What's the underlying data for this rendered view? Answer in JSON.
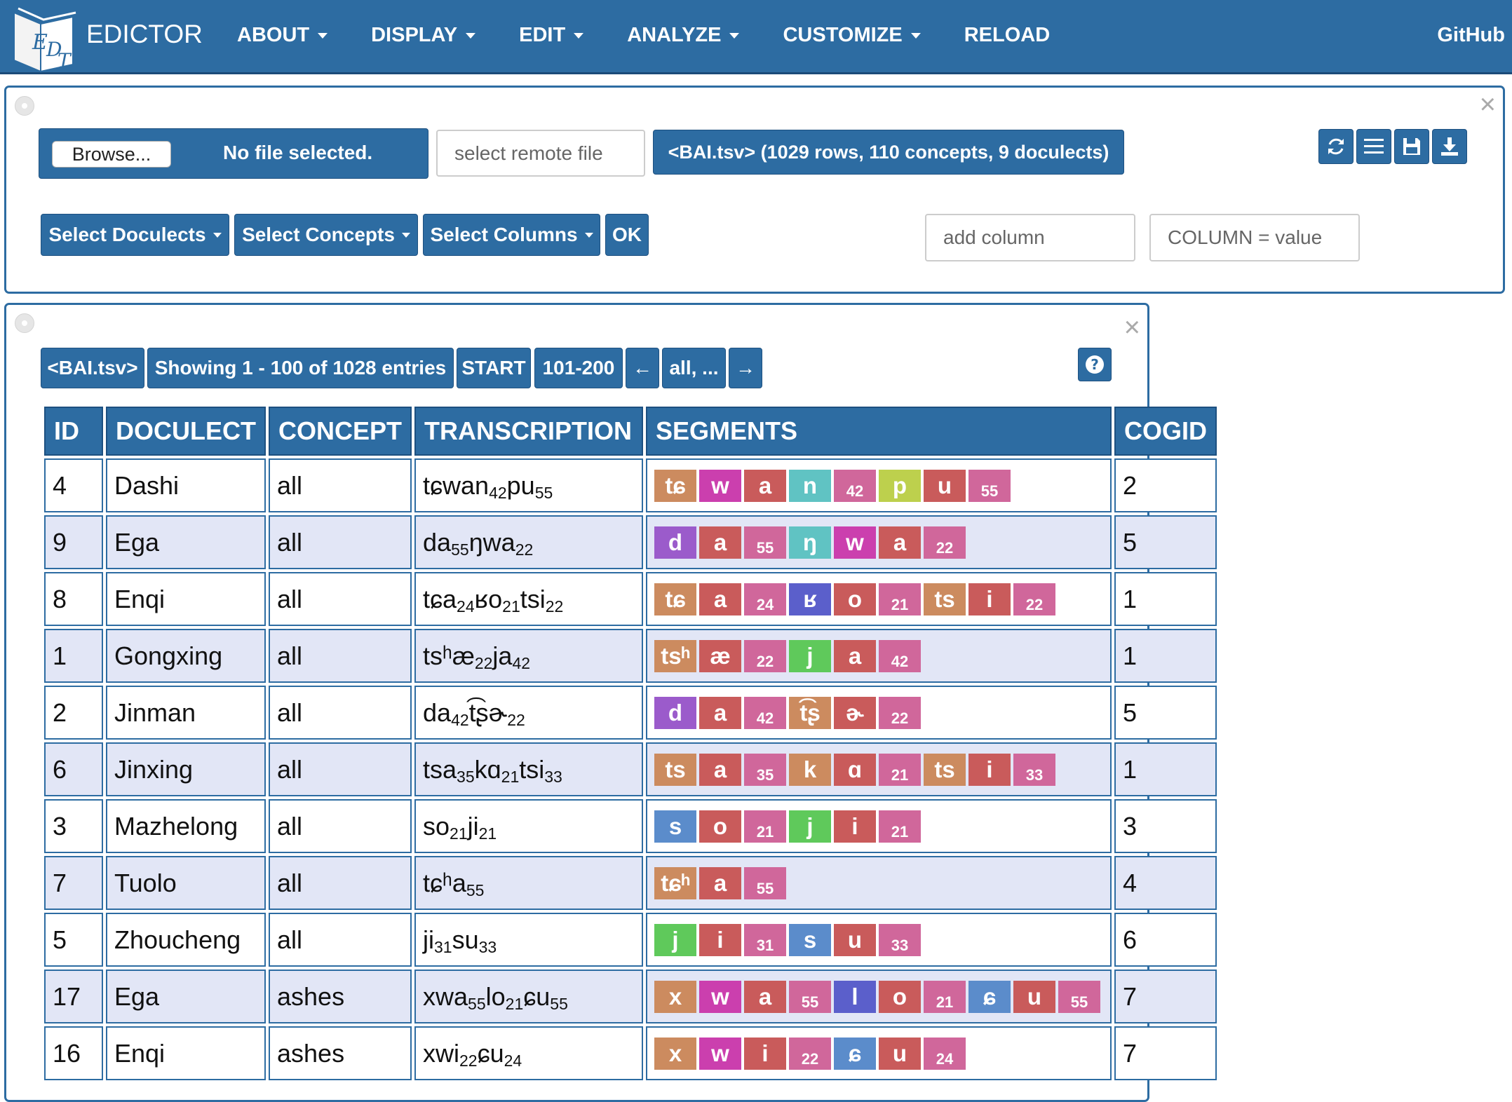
{
  "navbar": {
    "brand": "EDICTOR",
    "items": [
      {
        "label": "ABOUT",
        "dropdown": true
      },
      {
        "label": "DISPLAY",
        "dropdown": true
      },
      {
        "label": "EDIT",
        "dropdown": true
      },
      {
        "label": "ANALYZE",
        "dropdown": true
      },
      {
        "label": "CUSTOMIZE",
        "dropdown": true
      },
      {
        "label": "RELOAD",
        "dropdown": false
      }
    ],
    "github": "GitHub"
  },
  "file_panel": {
    "browse_label": "Browse...",
    "no_file_label": "No file selected.",
    "remote_placeholder": "select remote file",
    "file_info": "<BAI.tsv> (1029 rows, 110 concepts, 9 doculects)",
    "icons": [
      "refresh-icon",
      "list-icon",
      "save-icon",
      "download-icon"
    ],
    "select_doculects": "Select Doculects",
    "select_concepts": "Select Concepts",
    "select_columns": "Select Columns",
    "ok": "OK",
    "add_column_placeholder": "add column",
    "filter_placeholder": "COLUMN = value"
  },
  "table_panel": {
    "pager": {
      "file": "<BAI.tsv>",
      "showing": "Showing 1 - 100 of 1028 entries",
      "start": "START",
      "next_range": "101-200",
      "prev": "←",
      "all": "all, ...",
      "next": "→"
    },
    "help_icon": "question-circle-icon",
    "columns": [
      "ID",
      "DOCULECT",
      "CONCEPT",
      "TRANSCRIPTION",
      "SEGMENTS",
      "COGID"
    ],
    "rows": [
      {
        "id": "4",
        "doculect": "Dashi",
        "concept": "all",
        "transcription": [
          [
            "tɕwan",
            ""
          ],
          [
            "42",
            "s"
          ],
          [
            "pu",
            ""
          ],
          [
            "55",
            "s"
          ]
        ],
        "segments": [
          [
            "tɕ",
            "brown"
          ],
          [
            "w",
            "pink"
          ],
          [
            "a",
            "red"
          ],
          [
            "n",
            "teal"
          ],
          [
            "42",
            "rose"
          ],
          [
            "p",
            "olive"
          ],
          [
            "u",
            "red"
          ],
          [
            "55",
            "rose"
          ]
        ],
        "cogid": "2"
      },
      {
        "id": "9",
        "doculect": "Ega",
        "concept": "all",
        "transcription": [
          [
            "da",
            ""
          ],
          [
            "55",
            "s"
          ],
          [
            "ŋwa",
            ""
          ],
          [
            "22",
            "s"
          ]
        ],
        "segments": [
          [
            "d",
            "purple"
          ],
          [
            "a",
            "red"
          ],
          [
            "55",
            "rose"
          ],
          [
            "ŋ",
            "teal"
          ],
          [
            "w",
            "pink"
          ],
          [
            "a",
            "red"
          ],
          [
            "22",
            "rose"
          ]
        ],
        "cogid": "5"
      },
      {
        "id": "8",
        "doculect": "Enqi",
        "concept": "all",
        "transcription": [
          [
            "tɕa",
            ""
          ],
          [
            "24",
            "s"
          ],
          [
            "ʁo",
            ""
          ],
          [
            "21",
            "s"
          ],
          [
            "tsi",
            ""
          ],
          [
            "22",
            "s"
          ]
        ],
        "segments": [
          [
            "tɕ",
            "brown"
          ],
          [
            "a",
            "red"
          ],
          [
            "24",
            "rose"
          ],
          [
            "ʁ",
            "blue"
          ],
          [
            "o",
            "red"
          ],
          [
            "21",
            "rose"
          ],
          [
            "ts",
            "brown"
          ],
          [
            "i",
            "red"
          ],
          [
            "22",
            "rose"
          ]
        ],
        "cogid": "1"
      },
      {
        "id": "1",
        "doculect": "Gongxing",
        "concept": "all",
        "transcription": [
          [
            "tsʰæ",
            ""
          ],
          [
            "22",
            "s"
          ],
          [
            "ja",
            ""
          ],
          [
            "42",
            "s"
          ]
        ],
        "segments": [
          [
            "tsʰ",
            "brown"
          ],
          [
            "æ",
            "red"
          ],
          [
            "22",
            "rose"
          ],
          [
            "j",
            "green"
          ],
          [
            "a",
            "red"
          ],
          [
            "42",
            "rose"
          ]
        ],
        "cogid": "1"
      },
      {
        "id": "2",
        "doculect": "Jinman",
        "concept": "all",
        "transcription": [
          [
            "da",
            ""
          ],
          [
            "42",
            "s"
          ],
          [
            "t͡ʂɚ",
            ""
          ],
          [
            "22",
            "s"
          ]
        ],
        "segments": [
          [
            "d",
            "purple"
          ],
          [
            "a",
            "red"
          ],
          [
            "42",
            "rose"
          ],
          [
            "t͡ʂ",
            "brown"
          ],
          [
            "ɚ",
            "red"
          ],
          [
            "22",
            "rose"
          ]
        ],
        "cogid": "5"
      },
      {
        "id": "6",
        "doculect": "Jinxing",
        "concept": "all",
        "transcription": [
          [
            "tsa",
            ""
          ],
          [
            "35",
            "s"
          ],
          [
            "kɑ",
            ""
          ],
          [
            "21",
            "s"
          ],
          [
            "tsi",
            ""
          ],
          [
            "33",
            "s"
          ]
        ],
        "segments": [
          [
            "ts",
            "brown"
          ],
          [
            "a",
            "red"
          ],
          [
            "35",
            "rose"
          ],
          [
            "k",
            "brown"
          ],
          [
            "ɑ",
            "red"
          ],
          [
            "21",
            "rose"
          ],
          [
            "ts",
            "brown"
          ],
          [
            "i",
            "red"
          ],
          [
            "33",
            "rose"
          ]
        ],
        "cogid": "1"
      },
      {
        "id": "3",
        "doculect": "Mazhelong",
        "concept": "all",
        "transcription": [
          [
            "so",
            ""
          ],
          [
            "21",
            "s"
          ],
          [
            "ji",
            ""
          ],
          [
            "21",
            "s"
          ]
        ],
        "segments": [
          [
            "s",
            "steel"
          ],
          [
            "o",
            "red"
          ],
          [
            "21",
            "rose"
          ],
          [
            "j",
            "green"
          ],
          [
            "i",
            "red"
          ],
          [
            "21",
            "rose"
          ]
        ],
        "cogid": "3"
      },
      {
        "id": "7",
        "doculect": "Tuolo",
        "concept": "all",
        "transcription": [
          [
            "tɕʰa",
            ""
          ],
          [
            "55",
            "s"
          ]
        ],
        "segments": [
          [
            "tɕʰ",
            "brown"
          ],
          [
            "a",
            "red"
          ],
          [
            "55",
            "rose"
          ]
        ],
        "cogid": "4"
      },
      {
        "id": "5",
        "doculect": "Zhoucheng",
        "concept": "all",
        "transcription": [
          [
            "ji",
            ""
          ],
          [
            "31",
            "s"
          ],
          [
            "su",
            ""
          ],
          [
            "33",
            "s"
          ]
        ],
        "segments": [
          [
            "j",
            "green"
          ],
          [
            "i",
            "red"
          ],
          [
            "31",
            "rose"
          ],
          [
            "s",
            "steel"
          ],
          [
            "u",
            "red"
          ],
          [
            "33",
            "rose"
          ]
        ],
        "cogid": "6"
      },
      {
        "id": "17",
        "doculect": "Ega",
        "concept": "ashes",
        "transcription": [
          [
            "xwa",
            ""
          ],
          [
            "55",
            "s"
          ],
          [
            "lo",
            ""
          ],
          [
            "21",
            "s"
          ],
          [
            "ɕu",
            ""
          ],
          [
            "55",
            "s"
          ]
        ],
        "segments": [
          [
            "x",
            "brown"
          ],
          [
            "w",
            "pink"
          ],
          [
            "a",
            "red"
          ],
          [
            "55",
            "rose"
          ],
          [
            "l",
            "blue"
          ],
          [
            "o",
            "red"
          ],
          [
            "21",
            "rose"
          ],
          [
            "ɕ",
            "steel"
          ],
          [
            "u",
            "red"
          ],
          [
            "55",
            "rose"
          ]
        ],
        "cogid": "7"
      },
      {
        "id": "16",
        "doculect": "Enqi",
        "concept": "ashes",
        "transcription": [
          [
            "xwi",
            ""
          ],
          [
            "22",
            "s"
          ],
          [
            "ɕu",
            ""
          ],
          [
            "24",
            "s"
          ]
        ],
        "segments": [
          [
            "x",
            "brown"
          ],
          [
            "w",
            "pink"
          ],
          [
            "i",
            "red"
          ],
          [
            "22",
            "rose"
          ],
          [
            "ɕ",
            "steel"
          ],
          [
            "u",
            "red"
          ],
          [
            "24",
            "rose"
          ]
        ],
        "cogid": "7"
      }
    ]
  }
}
